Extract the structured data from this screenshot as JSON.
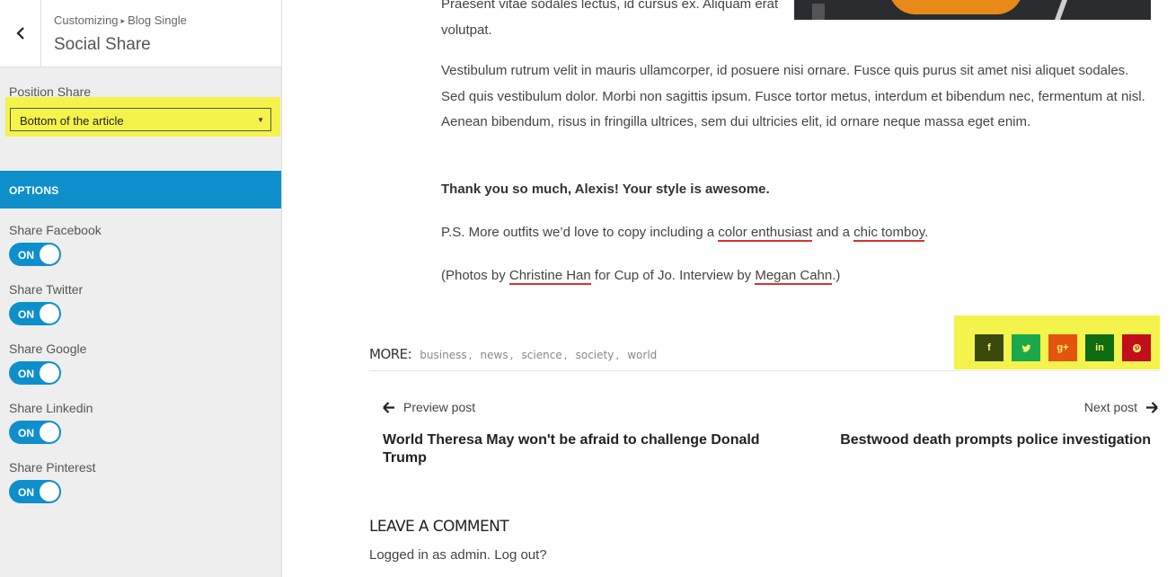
{
  "customizer": {
    "breadcrumb_root": "Customizing",
    "breadcrumb_sep": "▸",
    "breadcrumb_parent": "Blog Single",
    "title": "Social Share",
    "position_label": "Position Share",
    "position_value": "Bottom of the article",
    "options_heading": "OPTIONS",
    "toggles": [
      {
        "label": "Share Facebook",
        "state": "ON"
      },
      {
        "label": "Share Twitter",
        "state": "ON"
      },
      {
        "label": "Share Google",
        "state": "ON"
      },
      {
        "label": "Share Linkedin",
        "state": "ON"
      },
      {
        "label": "Share Pinterest",
        "state": "ON"
      }
    ],
    "accent_color": "#0e8fcb",
    "highlight_color": "#f3f34b"
  },
  "article": {
    "para_top": "Praesent vitae sodales lectus, id cursus ex. Aliquam erat volutpat.",
    "para_vestibulum": "Vestibulum rutrum velit in mauris ullamcorper, id posuere nisi ornare. Fusce quis purus sit amet nisi aliquet sodales. Sed quis vestibulum dolor. Morbi non sagittis ipsum. Fusce tortor metus, interdum et bibendum nec, fermentum at nisl. Aenean bibendum, risus in fringilla ultrices, sem dui ultricies elit, id ornare neque massa eget enim.",
    "thanks": "Thank you so much, Alexis! Your style is awesome.",
    "ps_prefix": "P.S. More outfits we’d love to copy including a ",
    "ps_link1": "color enthusiast",
    "ps_mid": " and a ",
    "ps_link2": "chic tomboy",
    "ps_suffix": ".",
    "photos_prefix": "(Photos by ",
    "photos_link1": "Christine Han",
    "photos_mid": " for Cup of Jo. Interview by ",
    "photos_link2": "Megan Cahn",
    "photos_suffix": ".)"
  },
  "more": {
    "label": "MORE:",
    "tags": [
      "business",
      "news",
      "science",
      "society",
      "world"
    ],
    "separator": ","
  },
  "share_buttons": [
    {
      "icon": "facebook-icon",
      "glyph": "f",
      "color": "#3a4a0c"
    },
    {
      "icon": "twitter-icon",
      "glyph": "t",
      "color": "#1aa84a"
    },
    {
      "icon": "google-plus-icon",
      "glyph": "g+",
      "color": "#e5540f"
    },
    {
      "icon": "linkedin-icon",
      "glyph": "in",
      "color": "#0f6b0f"
    },
    {
      "icon": "pinterest-icon",
      "glyph": "p",
      "color": "#c00e1d"
    }
  ],
  "post_nav": {
    "prev_label": "Preview post",
    "prev_title": "World Theresa May won't be afraid to challenge Donald Trump",
    "next_label": "Next post",
    "next_title": "Bestwood death prompts police investigation"
  },
  "comments": {
    "title": "LEAVE A COMMENT",
    "logged_in": "Logged in as admin. Log out?"
  }
}
